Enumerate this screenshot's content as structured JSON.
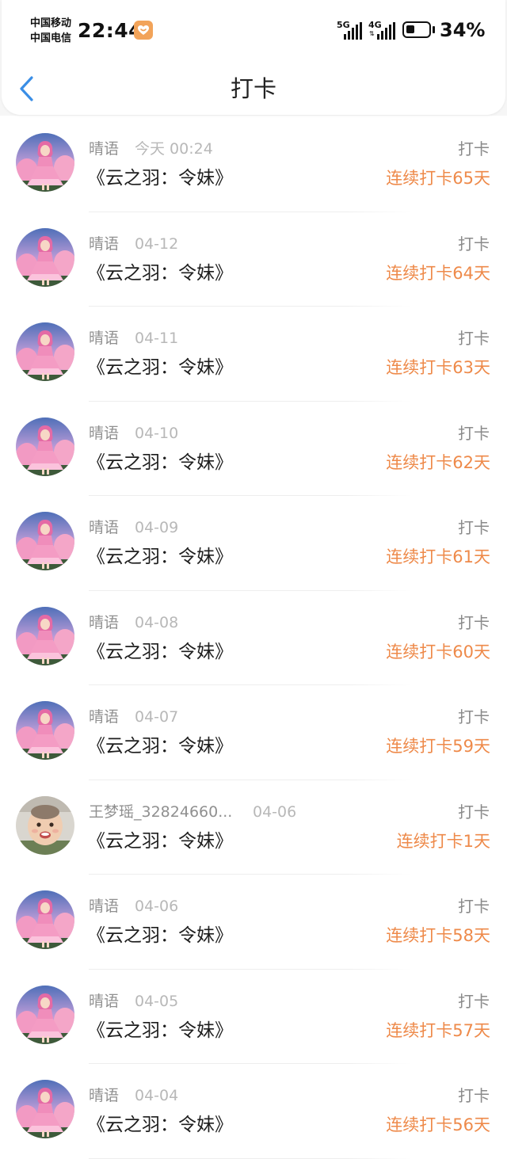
{
  "status_bar": {
    "carrier_1": "中国移动",
    "carrier_2": "中国电信",
    "time": "22:44",
    "signal_1_label": "5G",
    "signal_2_label": "4G",
    "signal_2_sub": "⇅",
    "battery_level": 0.34,
    "battery_text": "34%"
  },
  "header": {
    "title": "打卡",
    "back_icon": "chevron-left-icon",
    "accent_color": "#3a8ee6"
  },
  "colors": {
    "streak": "#ee8a4a",
    "muted": "#909090"
  },
  "checkins": [
    {
      "user": "晴语",
      "date": "今天 00:24",
      "book": "《云之羽：令妹》",
      "action": "打卡",
      "streak": "连续打卡65天",
      "avatar": "anime-pink"
    },
    {
      "user": "晴语",
      "date": "04-12",
      "book": "《云之羽：令妹》",
      "action": "打卡",
      "streak": "连续打卡64天",
      "avatar": "anime-pink"
    },
    {
      "user": "晴语",
      "date": "04-11",
      "book": "《云之羽：令妹》",
      "action": "打卡",
      "streak": "连续打卡63天",
      "avatar": "anime-pink"
    },
    {
      "user": "晴语",
      "date": "04-10",
      "book": "《云之羽：令妹》",
      "action": "打卡",
      "streak": "连续打卡62天",
      "avatar": "anime-pink"
    },
    {
      "user": "晴语",
      "date": "04-09",
      "book": "《云之羽：令妹》",
      "action": "打卡",
      "streak": "连续打卡61天",
      "avatar": "anime-pink"
    },
    {
      "user": "晴语",
      "date": "04-08",
      "book": "《云之羽：令妹》",
      "action": "打卡",
      "streak": "连续打卡60天",
      "avatar": "anime-pink"
    },
    {
      "user": "晴语",
      "date": "04-07",
      "book": "《云之羽：令妹》",
      "action": "打卡",
      "streak": "连续打卡59天",
      "avatar": "anime-pink"
    },
    {
      "user": "王梦瑶_32824660...",
      "date": "04-06",
      "book": "《云之羽：令妹》",
      "action": "打卡",
      "streak": "连续打卡1天",
      "avatar": "baby-photo"
    },
    {
      "user": "晴语",
      "date": "04-06",
      "book": "《云之羽：令妹》",
      "action": "打卡",
      "streak": "连续打卡58天",
      "avatar": "anime-pink"
    },
    {
      "user": "晴语",
      "date": "04-05",
      "book": "《云之羽：令妹》",
      "action": "打卡",
      "streak": "连续打卡57天",
      "avatar": "anime-pink"
    },
    {
      "user": "晴语",
      "date": "04-04",
      "book": "《云之羽：令妹》",
      "action": "打卡",
      "streak": "连续打卡56天",
      "avatar": "anime-pink"
    }
  ]
}
